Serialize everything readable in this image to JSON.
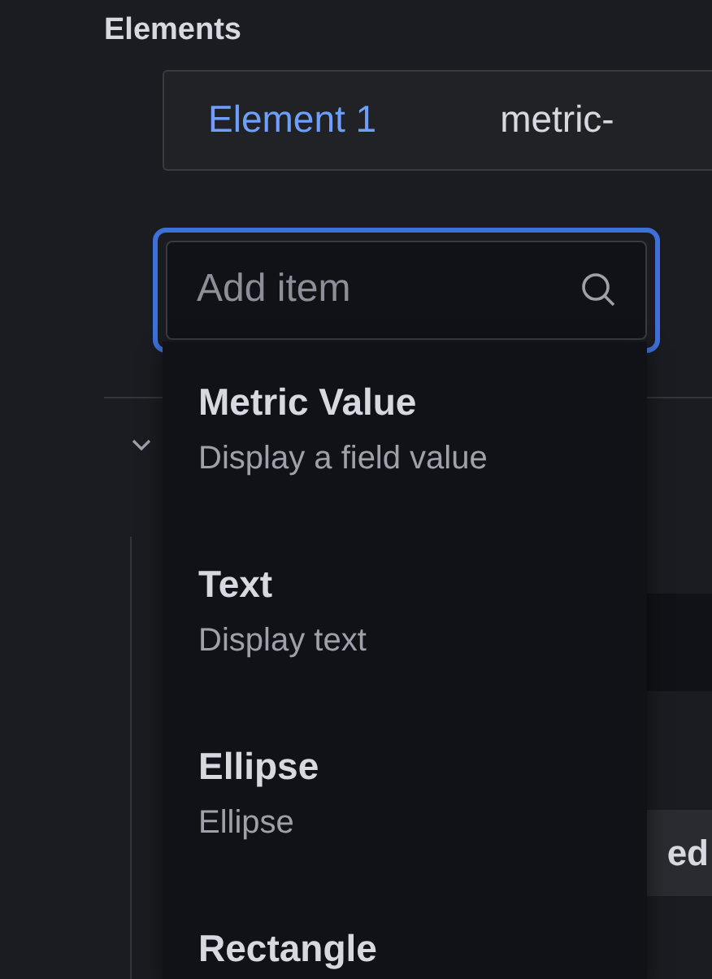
{
  "section_title": "Elements",
  "element_tabs": [
    {
      "label": "Element 1",
      "selected": true
    },
    {
      "label": "metric-",
      "selected": false
    }
  ],
  "search": {
    "placeholder": "Add item",
    "focused": true
  },
  "tree": {
    "expanded": true
  },
  "background_fragments": [
    {
      "text": "ed"
    }
  ],
  "menu_items": [
    {
      "title": "Metric Value",
      "description": "Display a field value"
    },
    {
      "title": "Text",
      "description": "Display text"
    },
    {
      "title": "Ellipse",
      "description": "Ellipse"
    },
    {
      "title": "Rectangle"
    }
  ]
}
